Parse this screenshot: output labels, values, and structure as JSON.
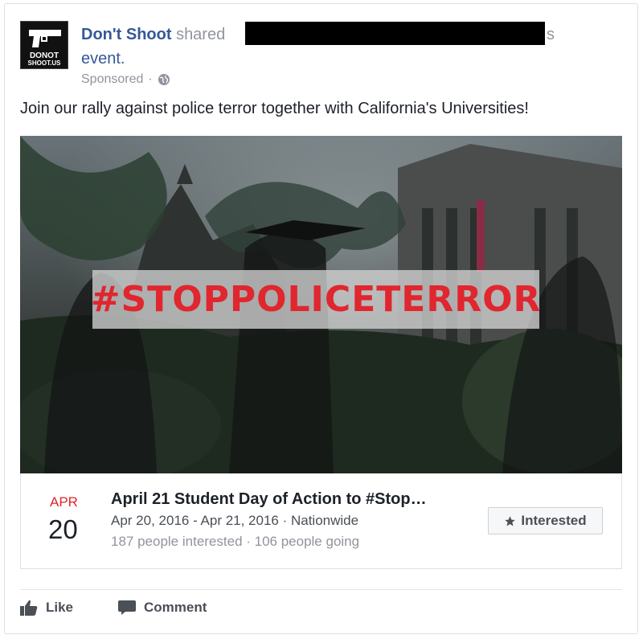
{
  "post": {
    "author": "Don't Shoot",
    "shared_text": "shared",
    "redacted_tail": "s",
    "event_word": "event.",
    "sponsored": "Sponsored",
    "globe_icon": "globe-icon",
    "message": "Join our rally against police terror together with California's Universities!"
  },
  "avatar": {
    "logo_line1": "DONOT",
    "logo_line2": "SHOOT.US"
  },
  "hero": {
    "hashtag": "#STOPPOLICETERROR"
  },
  "event": {
    "month": "APR",
    "day": "20",
    "title": "April 21 Student Day of Action to #Stop…",
    "dates": "Apr 20, 2016 - Apr 21, 2016 · Nationwide",
    "counts": "187 people interested · 106 people going",
    "interested_label": "Interested"
  },
  "actions": {
    "like": "Like",
    "comment": "Comment"
  },
  "colors": {
    "link": "#365899",
    "accent_red": "#e0262e",
    "muted": "#90949c"
  }
}
